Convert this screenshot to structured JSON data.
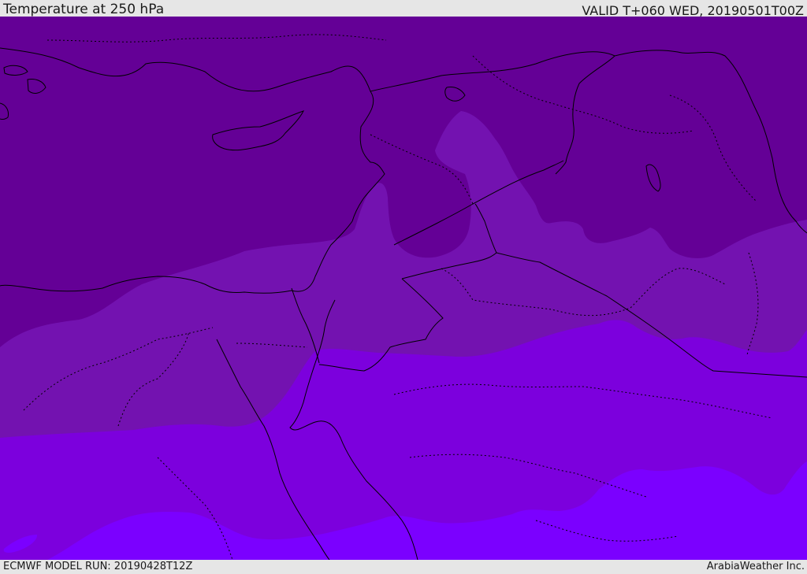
{
  "header": {
    "title": "Temperature at 250 hPa",
    "valid_time": "VALID T+060 WED, 20190501T00Z"
  },
  "footer": {
    "model_run": "ECMWF MODEL RUN: 20190428T12Z",
    "credit": "ArabiaWeather Inc."
  },
  "map": {
    "field": "temperature",
    "level": "250 hPa",
    "shading_colors": [
      "#640096",
      "#7312b0",
      "#7c00dd",
      "#7b00ff"
    ],
    "coastline_color": "#000000",
    "border_style": "dotted"
  }
}
